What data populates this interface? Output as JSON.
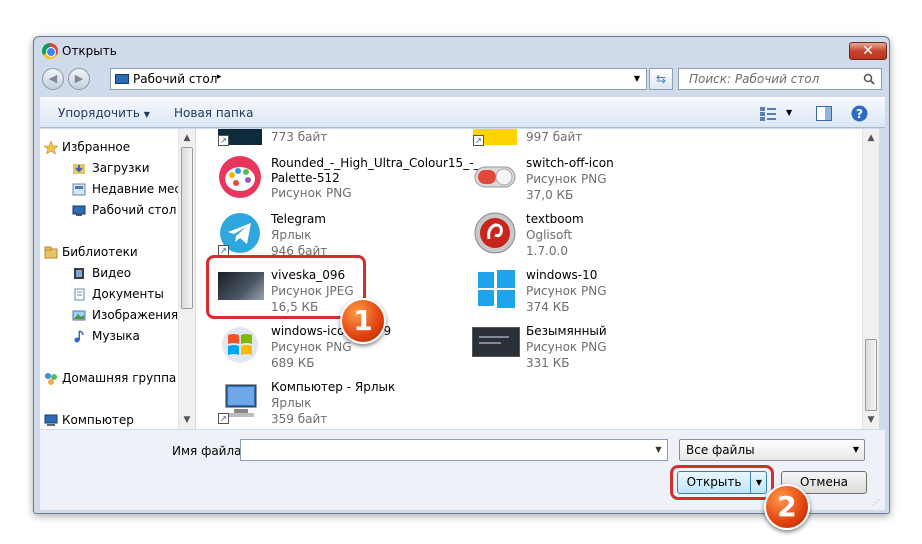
{
  "window": {
    "title": "Открыть",
    "close_label": "✕"
  },
  "address": {
    "path": "Рабочий стол",
    "sep": "▸"
  },
  "search": {
    "placeholder": "Поиск: Рабочий стол"
  },
  "toolbar": {
    "organize": "Упорядочить",
    "new_folder": "Новая папка"
  },
  "sidebar": {
    "favorites": "Избранное",
    "fav_items": [
      "Загрузки",
      "Недавние места",
      "Рабочий стол"
    ],
    "libraries": "Библиотеки",
    "lib_items": [
      "Видео",
      "Документы",
      "Изображения",
      "Музыка"
    ],
    "homegroup": "Домашняя группа",
    "computer": "Компьютер"
  },
  "files": {
    "left": [
      {
        "name": "",
        "sub1": "773 байт",
        "sub2": ""
      },
      {
        "name": "Rounded_-_High_Ultra_Colour15_-_",
        "name2": "Palette-512",
        "sub1": "Рисунок PNG",
        "sub2": ""
      },
      {
        "name": "Telegram",
        "sub1": "Ярлык",
        "sub2": "946 байт"
      },
      {
        "name": "viveska_096",
        "sub1": "Рисунок JPEG",
        "sub2": "16,5 КБ"
      },
      {
        "name": "windows-icon-png-9",
        "sub1": "Рисунок PNG",
        "sub2": "689 КБ"
      },
      {
        "name": "Компьютер - Ярлык",
        "sub1": "Ярлык",
        "sub2": "359 байт"
      }
    ],
    "right": [
      {
        "name": "",
        "sub1": "997 байт",
        "sub2": ""
      },
      {
        "name": "switch-off-icon",
        "sub1": "Рисунок PNG",
        "sub2": "37,0 КБ"
      },
      {
        "name": "textboom",
        "sub1": "Oglisoft",
        "sub2": "1.7.0.0"
      },
      {
        "name": "windows-10",
        "sub1": "Рисунок PNG",
        "sub2": "374 КБ"
      },
      {
        "name": "Безымянный",
        "sub1": "Рисунок PNG",
        "sub2": "331 КБ"
      }
    ]
  },
  "bottom": {
    "filename_label": "Имя файла:",
    "filename_value": "",
    "filter_value": "Все файлы",
    "open": "Открыть",
    "cancel": "Отмена"
  },
  "annotations": {
    "badge1": "1",
    "badge2": "2"
  },
  "colors": {
    "callout": "#d32f2f",
    "badge": "#e2420e",
    "accent": "#1e395b"
  }
}
